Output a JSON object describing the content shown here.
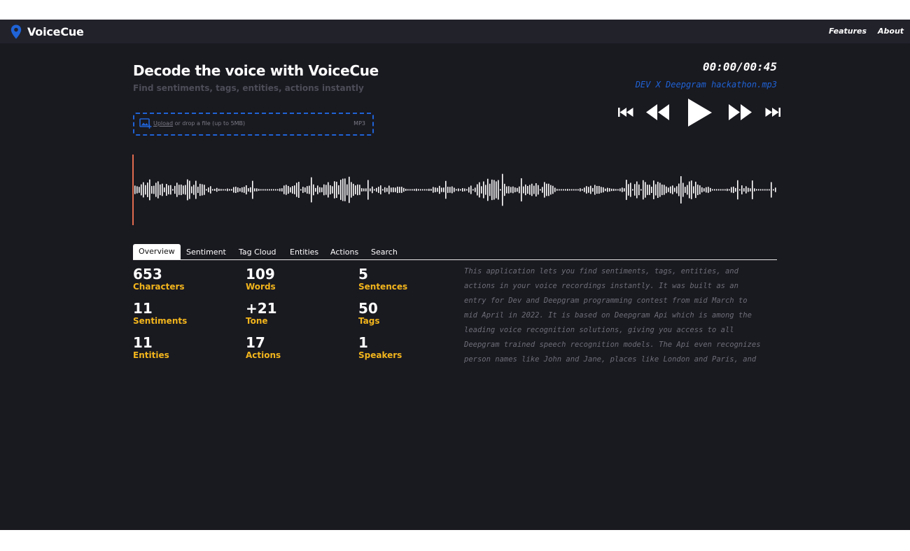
{
  "brand": {
    "name": "VoiceCue",
    "icon": "map-pin-icon",
    "icon_color": "#1f63d6"
  },
  "nav": {
    "features": "Features",
    "about": "About"
  },
  "hero": {
    "title": "Decode the voice with VoiceCue",
    "subtitle": "Find sentiments, tags, entities, actions instantly"
  },
  "upload": {
    "icon": "image-add-icon",
    "link_text": "Upload",
    "text": " or drop a file (up to 5MB)",
    "format": "MP3"
  },
  "player": {
    "time": "00:00/00:45",
    "filename": "DEV X Deepgram hackathon.mp3",
    "controls": [
      "skip-back-icon",
      "rewind-icon",
      "play-icon",
      "fast-forward-icon",
      "skip-forward-icon"
    ],
    "progress": 0
  },
  "tabs": [
    "Overview",
    "Sentiment",
    "Tag Cloud",
    "Entities",
    "Actions",
    "Search"
  ],
  "stats": [
    {
      "value": "653",
      "label": "Characters"
    },
    {
      "value": "109",
      "label": "Words"
    },
    {
      "value": "5",
      "label": "Sentences"
    },
    {
      "value": "11",
      "label": "Sentiments"
    },
    {
      "value": "+21",
      "label": "Tone"
    },
    {
      "value": "50",
      "label": "Tags"
    },
    {
      "value": "11",
      "label": "Entities"
    },
    {
      "value": "17",
      "label": "Actions"
    },
    {
      "value": "1",
      "label": "Speakers"
    }
  ],
  "description": "This application lets you find sentiments, tags, entities, and\nactions in your voice recordings instantly. It was built as an\nentry for Dev and Deepgram programming contest from mid March to\nmid April in 2022. It is based on Deepgram Api which is among the\nleading voice recognition solutions, giving you access to all\nDeepgram trained speech recognition models. The Api even recognizes\nperson names like John and Jane, places like London and Paris, and",
  "colors": {
    "accent": "#1f63d6",
    "label": "#f2b51c",
    "playhead": "#e06b4c",
    "background": "#191920"
  }
}
